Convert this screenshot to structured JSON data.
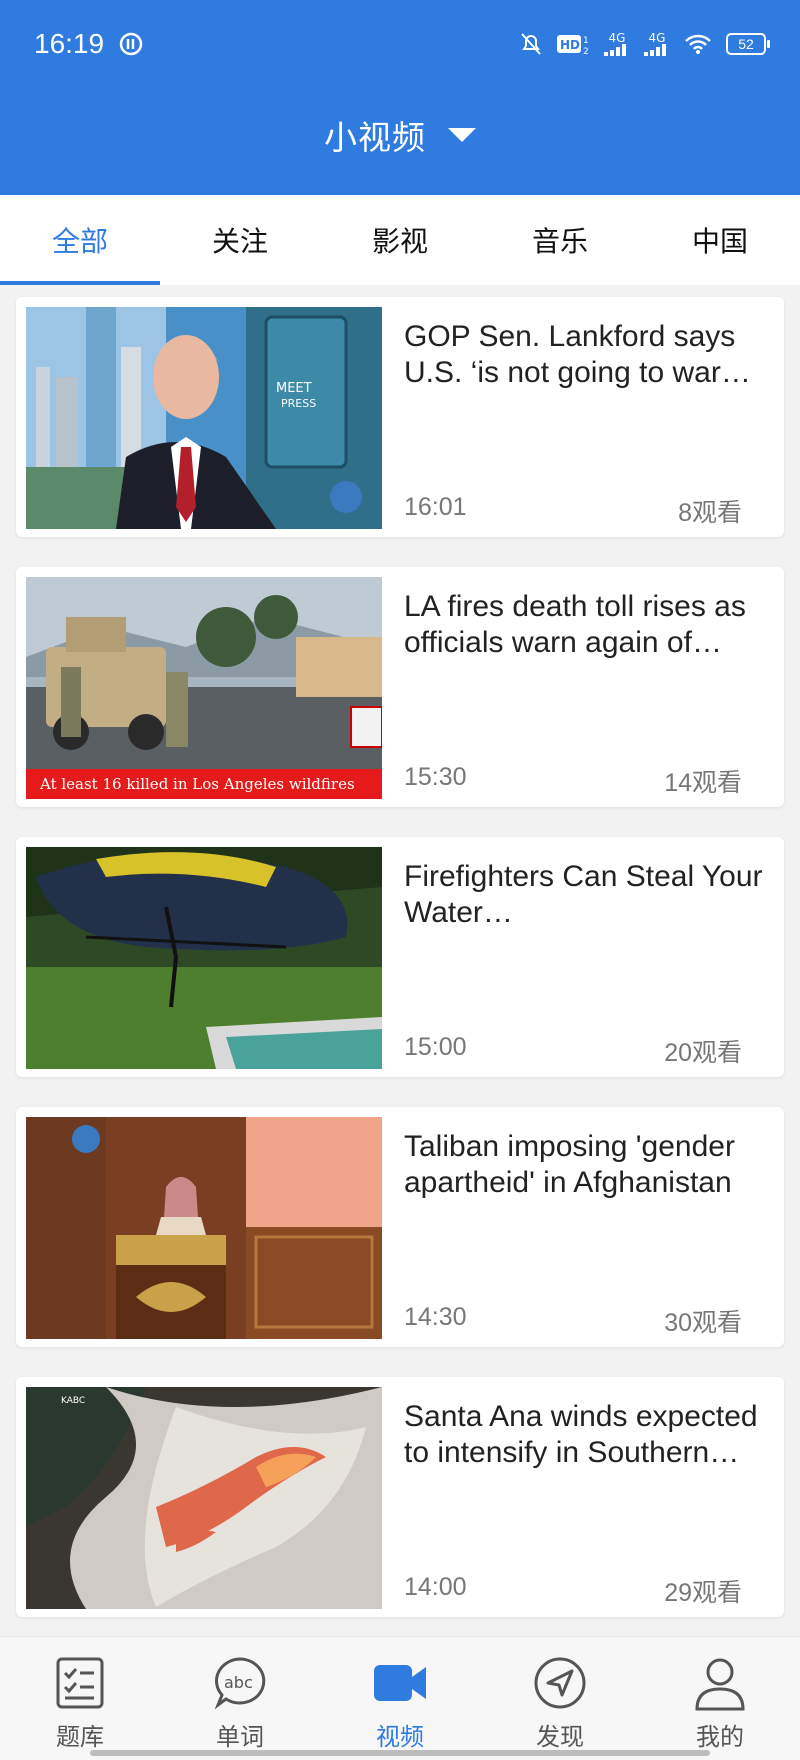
{
  "status_bar": {
    "time": "16:19",
    "network_1": "4G",
    "network_2": "4G",
    "battery": "52"
  },
  "header": {
    "title": "小视频"
  },
  "tabs": [
    {
      "label": "全部",
      "active": true
    },
    {
      "label": "关注",
      "active": false
    },
    {
      "label": "影视",
      "active": false
    },
    {
      "label": "音乐",
      "active": false
    },
    {
      "label": "中国",
      "active": false
    }
  ],
  "videos": [
    {
      "title": "GOP Sen. Lankford says U.S. ‘is not going to war with Canada’",
      "time": "16:01",
      "views": "8观看"
    },
    {
      "title": " LA fires death toll rises as officials warn again of dangerous winds",
      "time": "15:30",
      "views": "14观看",
      "caption": "At least 16 killed in Los Angeles wildfires"
    },
    {
      "title": "Firefighters Can Steal Your Water…",
      "time": "15:00",
      "views": "20观看"
    },
    {
      "title": "Taliban imposing 'gender apartheid' in Afghanistan",
      "time": "14:30",
      "views": "30观看"
    },
    {
      "title": "Santa Ana winds expected to intensify in Southern California",
      "time": "14:00",
      "views": "29观看"
    }
  ],
  "bottom_nav": [
    {
      "label": "题库",
      "icon": "checklist-icon",
      "active": false
    },
    {
      "label": "单词",
      "icon": "abc-bubble-icon",
      "active": false
    },
    {
      "label": "视频",
      "icon": "video-camera-icon",
      "active": true
    },
    {
      "label": "发现",
      "icon": "compass-icon",
      "active": false
    },
    {
      "label": "我的",
      "icon": "person-icon",
      "active": false
    }
  ],
  "colors": {
    "accent": "#2f7be0",
    "background": "#f2f2f2"
  }
}
